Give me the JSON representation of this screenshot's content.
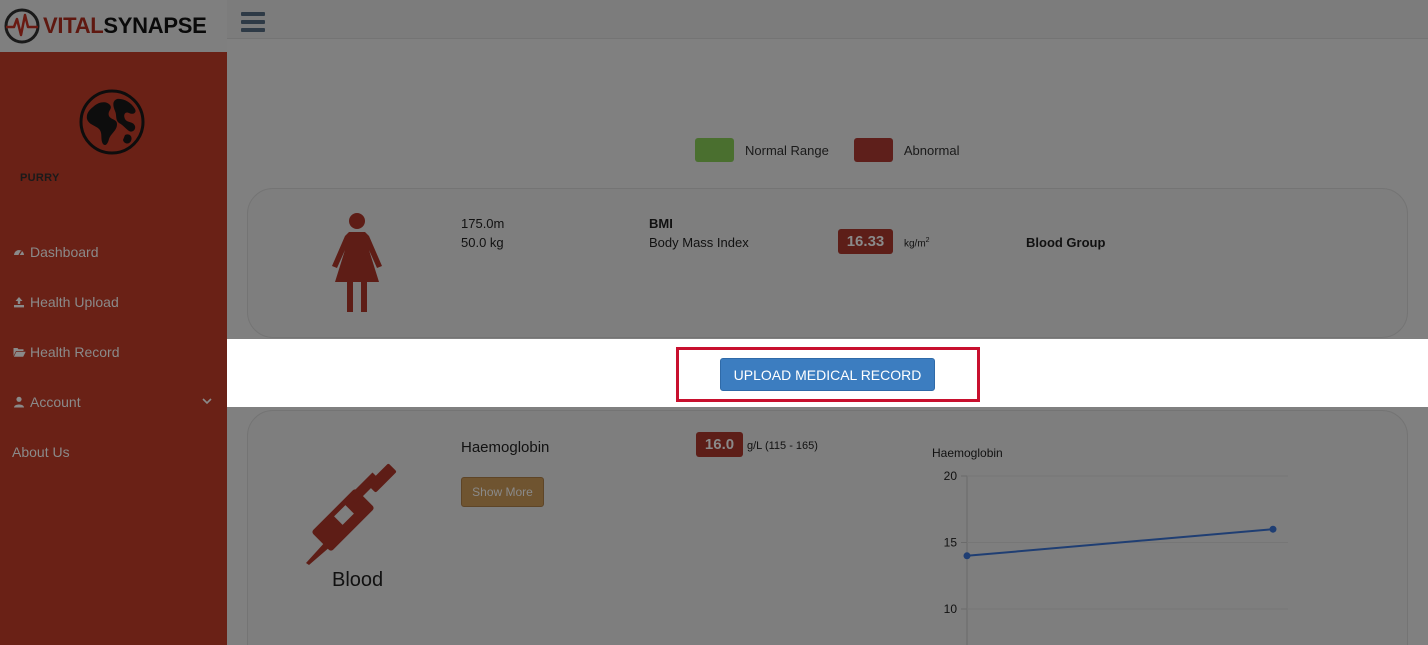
{
  "brand": {
    "part1": "VITAL",
    "part2": "SYNAPSE"
  },
  "sidebar": {
    "username": "PURRY",
    "items": [
      {
        "label": "Dashboard",
        "icon": "dashboard-icon"
      },
      {
        "label": "Health Upload",
        "icon": "upload-icon"
      },
      {
        "label": "Health Record",
        "icon": "folder-open-icon"
      },
      {
        "label": "Account",
        "icon": "user-icon",
        "has_submenu": true
      },
      {
        "label": "About Us"
      }
    ]
  },
  "legend": {
    "normal": {
      "label": "Normal Range",
      "color": "#4a6f2f"
    },
    "abnormal": {
      "label": "Abnormal",
      "color": "#5e1f1b"
    }
  },
  "profile": {
    "height": "175.0m",
    "weight": "50.0 kg",
    "bmi_title": "BMI",
    "bmi_desc": "Body Mass Index",
    "bmi_value": "16.33",
    "bmi_unit": "kg/m",
    "bmi_unit_sup": "2",
    "blood_group_label": "Blood Group"
  },
  "upload_button": {
    "label": "UPLOAD MEDICAL RECORD"
  },
  "blood": {
    "category": "Blood",
    "test_name": "Haemoglobin",
    "value": "16.0",
    "unit_range": "g/L (115 - 165)",
    "show_more": "Show More"
  },
  "chart_data": {
    "type": "line",
    "title": "Haemoglobin",
    "series": [
      {
        "values": [
          14.0,
          16.0
        ]
      }
    ],
    "ylim": [
      10,
      20
    ],
    "yticks": [
      20,
      15,
      10
    ],
    "grid": true,
    "line_color": "#1f3e73"
  }
}
